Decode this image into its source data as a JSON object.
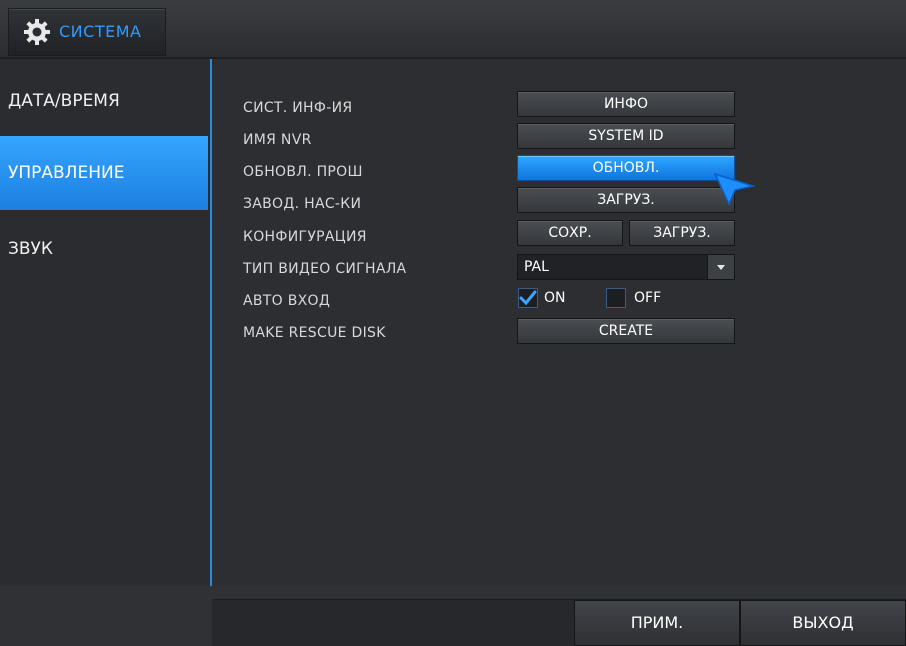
{
  "window": {
    "title": "СИСТЕМА",
    "title_icon": "gear-icon"
  },
  "sidebar": {
    "items": [
      {
        "label": "ДАТА/ВРЕМЯ",
        "active": false
      },
      {
        "label": "УПРАВЛЕНИЕ",
        "active": true
      },
      {
        "label": "ЗВУК",
        "active": false
      }
    ]
  },
  "settings": {
    "rows": [
      {
        "label": "СИСТ. ИНФ-ИЯ",
        "button": "ИНФО"
      },
      {
        "label": "ИМЯ NVR",
        "button": "SYSTEM ID"
      },
      {
        "label": "ОБНОВЛ. ПРОШ",
        "button": "ОБНОВЛ."
      },
      {
        "label": "ЗАВОД. НАС-КИ",
        "button": "ЗАГРУЗ."
      },
      {
        "label": "КОНФИГУРАЦИЯ",
        "button_save": "СОХР.",
        "button_load": "ЗАГРУЗ."
      },
      {
        "label": "ТИП ВИДЕО СИГНАЛА",
        "select_value": "PAL"
      },
      {
        "label": "АВТО ВХОД",
        "on_label": "ON",
        "off_label": "OFF",
        "on_checked": true,
        "off_checked": false
      },
      {
        "label": "MAKE RESCUE DISK",
        "button": "CREATE"
      }
    ]
  },
  "footer": {
    "apply_label": "ПРИМ.",
    "exit_label": "ВЫХОД"
  },
  "colors": {
    "accent": "#2f9bff",
    "active_item": "#1c7fe0",
    "background": "#2c2e31"
  }
}
